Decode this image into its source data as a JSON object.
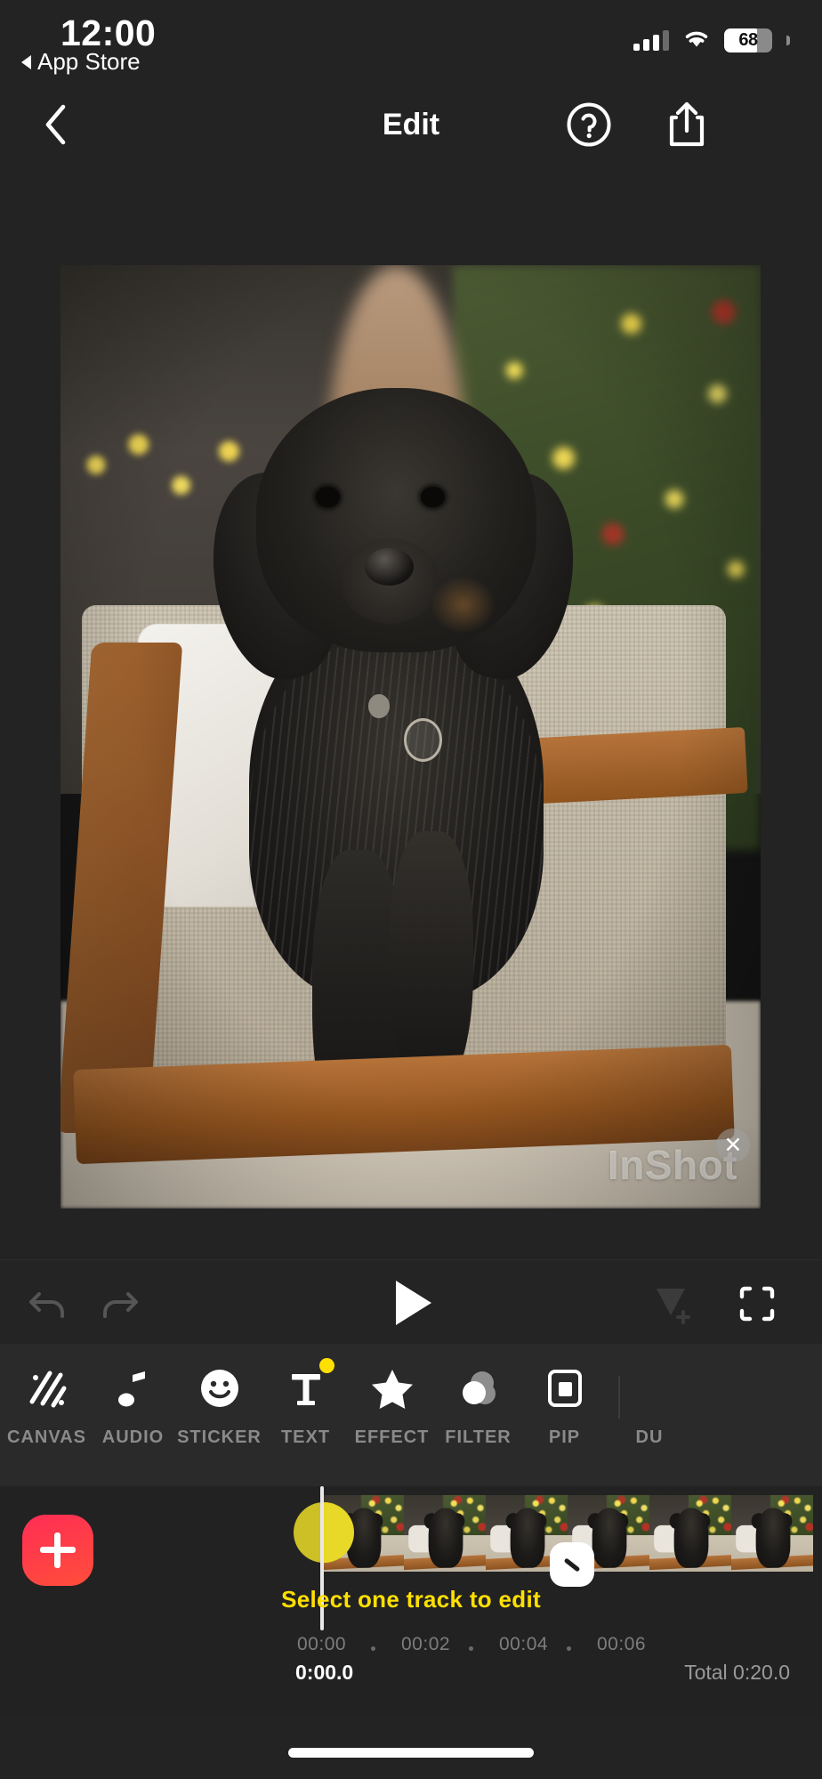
{
  "status_bar": {
    "time": "12:00",
    "back_app": "App Store",
    "battery_percent": "68",
    "battery_level": 68,
    "signal_icon": "cellular-signal-icon",
    "wifi_icon": "wifi-icon",
    "battery_icon": "battery-icon"
  },
  "nav": {
    "title": "Edit",
    "back_icon": "chevron-left-icon",
    "help_icon": "question-mark-circle-icon",
    "share_icon": "share-export-icon"
  },
  "preview": {
    "watermark": "InShot",
    "watermark_close_icon": "close-x-icon",
    "alt": "Black wire-haired dog lying on a beige upholstered mid-century couch in front of a lit Christmas tree"
  },
  "player": {
    "undo_icon": "undo-arrow-icon",
    "redo_icon": "redo-arrow-icon",
    "play_icon": "play-triangle-icon",
    "keyframe_icon": "add-keyframe-icon",
    "fullscreen_icon": "fullscreen-expand-icon"
  },
  "tools": [
    {
      "label": "CANVAS",
      "icon": "canvas-diagonal-stripes-icon",
      "badge": false
    },
    {
      "label": "AUDIO",
      "icon": "music-note-icon",
      "badge": false
    },
    {
      "label": "STICKER",
      "icon": "smiley-face-icon",
      "badge": false
    },
    {
      "label": "TEXT",
      "icon": "text-t-icon",
      "badge": true
    },
    {
      "label": "EFFECT",
      "icon": "star-icon",
      "badge": false
    },
    {
      "label": "FILTER",
      "icon": "overlapping-circles-icon",
      "badge": false
    },
    {
      "label": "PIP",
      "icon": "picture-in-picture-icon",
      "badge": false
    },
    {
      "label": "DU",
      "icon": "duplicate-icon",
      "badge": false
    }
  ],
  "timeline": {
    "add_button_icon": "plus-icon",
    "transition_icon": "transition-marker-icon",
    "trim_handle_icon": "trim-slash-icon",
    "playhead_icon": "playhead-icon",
    "hint": "Select one track to edit",
    "ruler_ticks": [
      "00:00",
      "00:02",
      "00:04",
      "00:06"
    ],
    "current_time": "0:00.0",
    "total_time": "Total 0:20.0",
    "clip_count": 5
  },
  "colors": {
    "accent_yellow": "#ffe000",
    "add_button_red": "#ff2d55",
    "background": "#232323",
    "toolstrip_bg": "#2a2a2a",
    "timeline_bg": "#222222",
    "label_gray": "#8a8a8a"
  }
}
